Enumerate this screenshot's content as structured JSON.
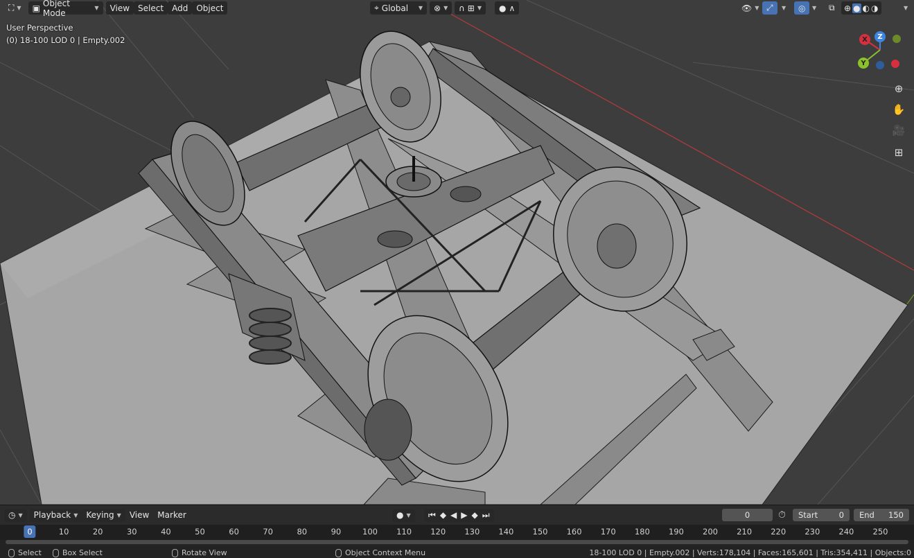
{
  "header": {
    "mode": "Object Mode",
    "menus": [
      "View",
      "Select",
      "Add",
      "Object"
    ],
    "transform_orientation": "Global"
  },
  "viewport": {
    "view_name": "User Perspective",
    "object_info": "(0) 18-100 LOD 0 | Empty.002"
  },
  "gizmo": {
    "x": "X",
    "y": "Y",
    "z": "Z"
  },
  "timeline": {
    "menus": [
      "Playback",
      "Keying",
      "View",
      "Marker"
    ],
    "current_frame": "0",
    "start_label": "Start",
    "start_value": "0",
    "end_label": "End",
    "end_value": "150",
    "ticks": [
      "0",
      "10",
      "20",
      "30",
      "40",
      "50",
      "60",
      "70",
      "80",
      "90",
      "100",
      "110",
      "120",
      "130",
      "140",
      "150",
      "160",
      "170",
      "180",
      "190",
      "200",
      "210",
      "220",
      "230",
      "240",
      "250"
    ]
  },
  "statusbar": {
    "select": "Select",
    "box_select": "Box Select",
    "rotate_view": "Rotate View",
    "context_menu": "Object Context Menu",
    "stats": "18-100 LOD 0 | Empty.002 | Verts:178,104 | Faces:165,601 | Tris:354,411 | Objects:0"
  },
  "colors": {
    "viewport_bg": "#3d3d3d",
    "accent": "#4772b3",
    "x_axis": "#d6303f",
    "y_axis": "#8bc12a",
    "z_axis": "#3d85e0"
  }
}
